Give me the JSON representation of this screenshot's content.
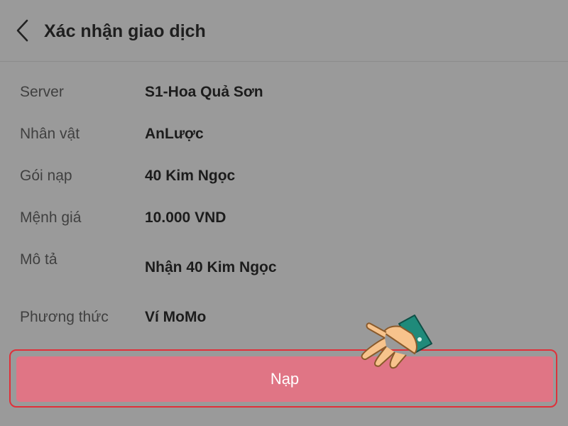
{
  "header": {
    "title": "Xác nhận giao dịch",
    "back_icon": "chevron-left-icon"
  },
  "details": [
    {
      "label": "Server",
      "value": "S1-Hoa Quả Sơn"
    },
    {
      "label": "Nhân vật",
      "value": "AnLược"
    },
    {
      "label": "Gói nạp",
      "value": "40 Kim Ngọc"
    },
    {
      "label": "Mệnh giá",
      "value": "10.000 VND"
    },
    {
      "label": "Mô tả",
      "value": "Nhận 40 Kim Ngọc"
    },
    {
      "label": "Phương thức",
      "value": "Ví MoMo"
    }
  ],
  "action": {
    "label": "Nạp",
    "color": "#e07585",
    "highlight_color": "#e0303a"
  },
  "pointer": {
    "icon": "pointing-hand-icon"
  },
  "colors": {
    "overlay_background": "#9a9a9a"
  }
}
